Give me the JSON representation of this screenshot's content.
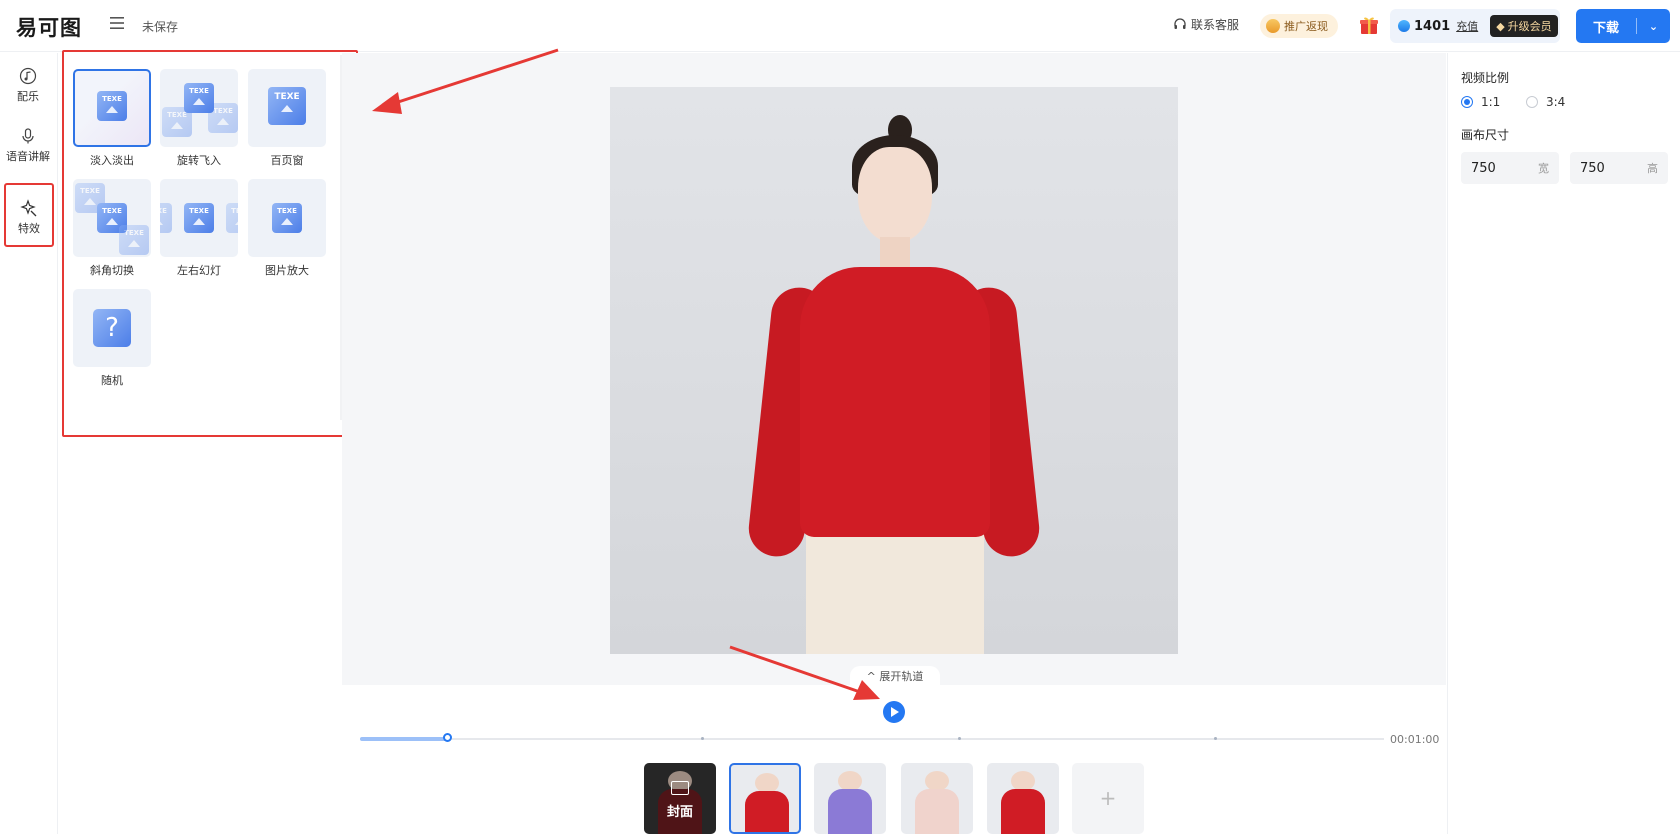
{
  "header": {
    "logo": "易可图",
    "status": "未保存",
    "support": "联系客服",
    "promo": "推广返现",
    "points": "1401",
    "recharge": "充值",
    "vip": "升级会员",
    "download": "下载"
  },
  "rail": {
    "items": [
      {
        "label": "配乐",
        "icon": "music-note-icon"
      },
      {
        "label": "语音讲解",
        "icon": "microphone-icon"
      },
      {
        "label": "特效",
        "icon": "sparkle-icon"
      }
    ]
  },
  "effects": {
    "items": [
      {
        "label": "淡入淡出",
        "selected": true
      },
      {
        "label": "旋转飞入"
      },
      {
        "label": "百页窗"
      },
      {
        "label": "斜角切换"
      },
      {
        "label": "左右幻灯"
      },
      {
        "label": "图片放大"
      },
      {
        "label": "随机"
      }
    ],
    "tile_text": "TEXE"
  },
  "stage": {
    "expand_track": "展开轨道"
  },
  "timeline": {
    "progress": 0.085,
    "total_time": "00:01:00",
    "frames": [
      {
        "label": "封面",
        "color": "#7a1f24"
      },
      {
        "color": "#d01c25",
        "selected": true
      },
      {
        "color": "#8b7ad6"
      },
      {
        "color": "#f0d3cc"
      },
      {
        "color": "#d01c25"
      }
    ],
    "add_label": "+"
  },
  "props": {
    "ratio_label": "视频比例",
    "ratio_options": [
      "1:1",
      "3:4"
    ],
    "ratio_selected": "1:1",
    "canvas_label": "画布尺寸",
    "width_value": "750",
    "width_unit": "宽",
    "height_value": "750",
    "height_unit": "高"
  },
  "colors": {
    "accent": "#2478f2",
    "annotation": "#e53935"
  }
}
